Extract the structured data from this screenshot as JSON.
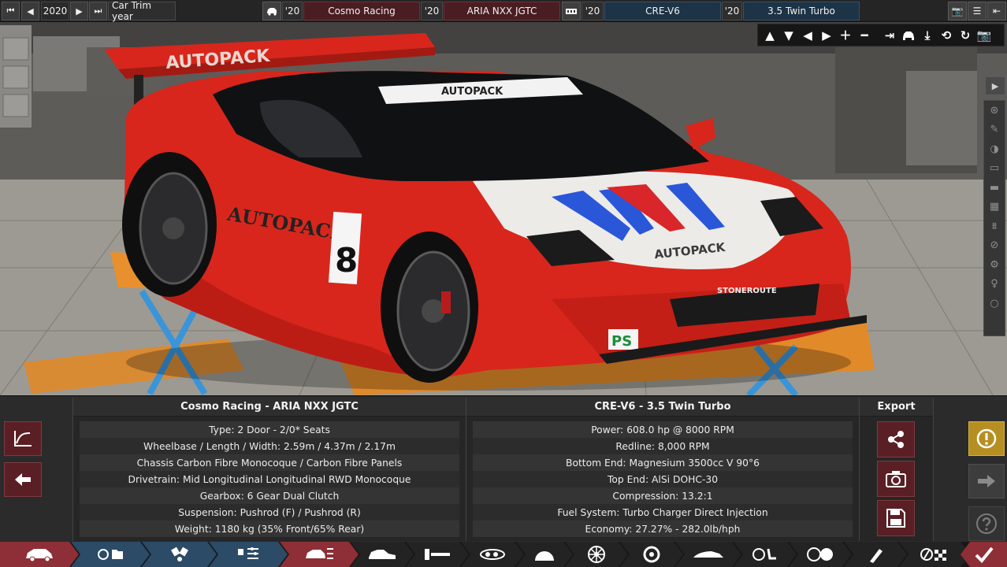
{
  "topbar": {
    "year": "2020",
    "trim_label": "Car Trim year",
    "model_year_short": "'20",
    "brand": "Cosmo Racing",
    "family_year_short": "'20",
    "model": "ARIA NXX JGTC",
    "engine_year_short": "'20",
    "engine": "CRE-V6",
    "variant_year_short": "'20",
    "variant": "3.5 Twin Turbo"
  },
  "car_panel": {
    "title": "Cosmo Racing - ARIA NXX JGTC",
    "rows": [
      "Type: 2 Door - 2/0* Seats",
      "Wheelbase / Length / Width: 2.59m / 4.37m / 2.17m",
      "Chassis Carbon Fibre Monocoque / Carbon Fibre Panels",
      "Drivetrain: Mid Longitudinal Longitudinal RWD Monocoque",
      "Gearbox: 6 Gear Dual Clutch",
      "Suspension: Pushrod (F) / Pushrod (R)",
      "Weight: 1180 kg (35% Front/65% Rear)"
    ]
  },
  "engine_panel": {
    "title": "CRE-V6 - 3.5 Twin Turbo",
    "rows": [
      "Power: 608.0 hp @ 8000 RPM",
      "Redline:  8,000 RPM",
      "Bottom End: Magnesium 3500cc V 90°6",
      "Top End: AlSi DOHC-30",
      "Compression: 13.2:1",
      "Fuel System: Turbo Charger Direct Injection",
      "Economy: 27.27% - 282.0lb/hph"
    ]
  },
  "export_panel": {
    "title": "Export"
  },
  "decals": {
    "wing": "AUTOPACK",
    "windshield": "AUTOPACK",
    "door": "AUTOPACK",
    "hood": "AUTOPACK",
    "number": "8",
    "bumper": "STONEROUTE",
    "sponsor": "PS"
  },
  "colors": {
    "accent_red": "#8e2e36",
    "accent_blue": "#2b4b66",
    "warning": "#b58f22",
    "car_body": "#d8261c"
  }
}
